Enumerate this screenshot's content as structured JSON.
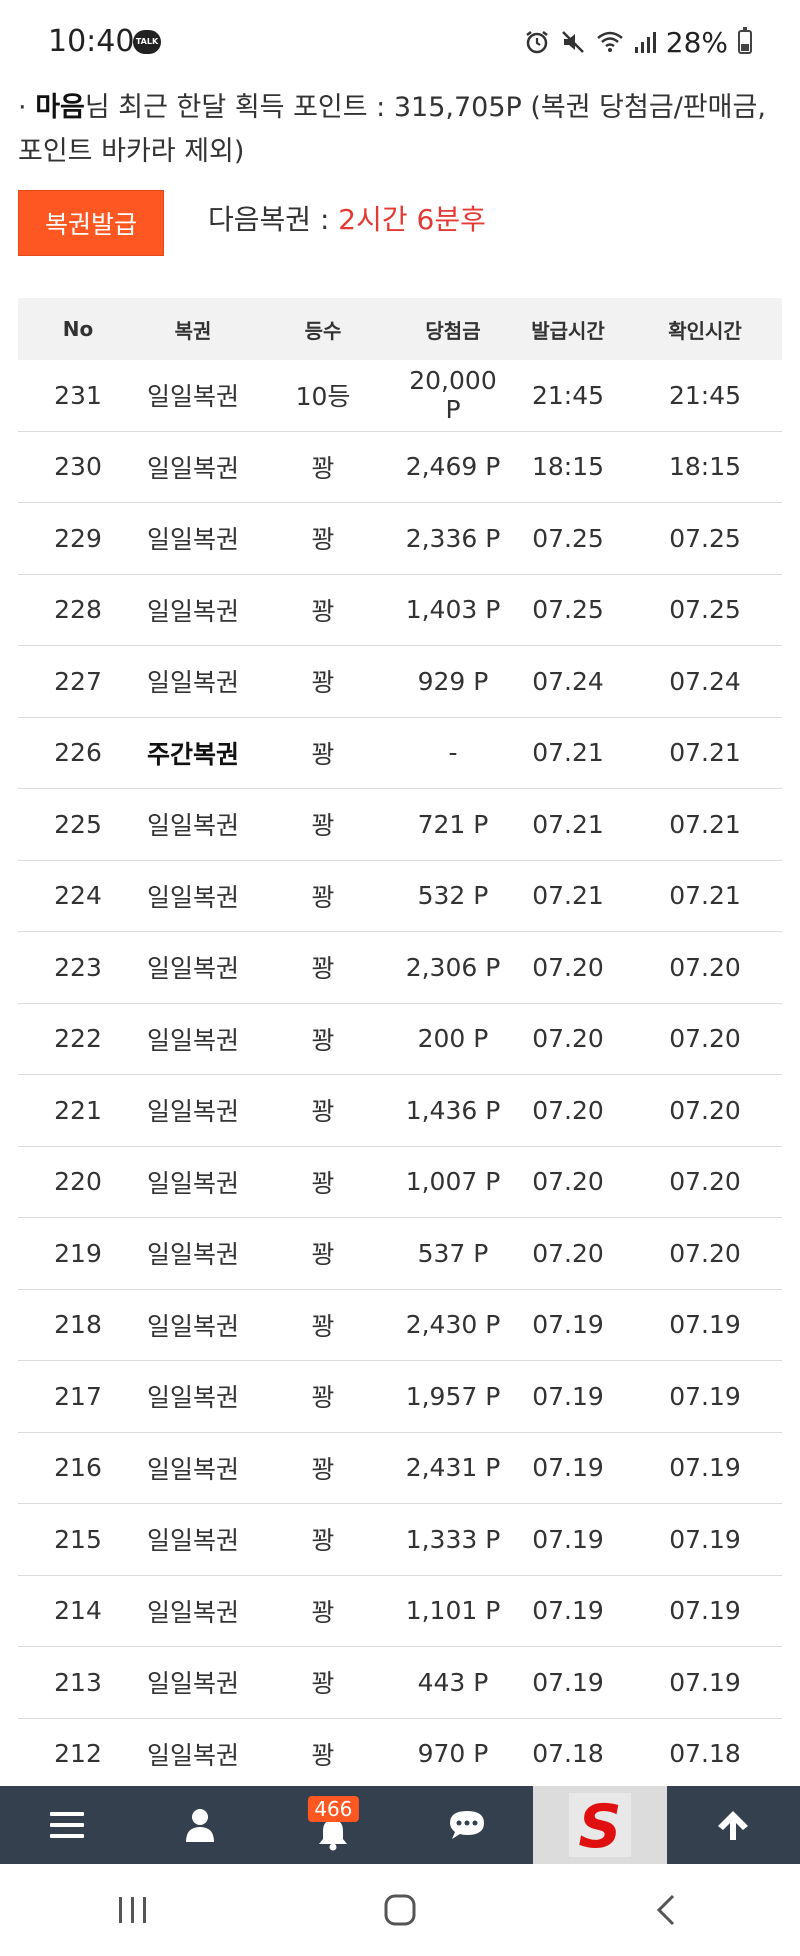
{
  "status_bar": {
    "time": "10:40",
    "talk_badge": "TALK",
    "battery": "28%",
    "icons": [
      "alarm-icon",
      "mute-icon",
      "wifi-icon",
      "signal-icon",
      "battery-icon"
    ]
  },
  "info": {
    "bullet": "·",
    "user": "마음",
    "text": "님 최근 한달 획득 포인트 : 315,705P (복권 당첨금/판매금, 포인트 바카라 제외)"
  },
  "issue_button": "복권발급",
  "next_lottery": {
    "label": "다음복권 : ",
    "time": "2시간 6분후"
  },
  "table": {
    "headers": {
      "no": "No",
      "type": "복권",
      "grade": "등수",
      "prize": "당첨금",
      "issued": "발급시간",
      "checked": "확인시간"
    },
    "rows": [
      {
        "no": "231",
        "type": "일일복권",
        "grade": "10등",
        "prize": "20,000 P",
        "issued": "21:45",
        "checked": "21:45"
      },
      {
        "no": "230",
        "type": "일일복권",
        "grade": "꽝",
        "prize": "2,469 P",
        "issued": "18:15",
        "checked": "18:15"
      },
      {
        "no": "229",
        "type": "일일복권",
        "grade": "꽝",
        "prize": "2,336 P",
        "issued": "07.25",
        "checked": "07.25"
      },
      {
        "no": "228",
        "type": "일일복권",
        "grade": "꽝",
        "prize": "1,403 P",
        "issued": "07.25",
        "checked": "07.25"
      },
      {
        "no": "227",
        "type": "일일복권",
        "grade": "꽝",
        "prize": "929 P",
        "issued": "07.24",
        "checked": "07.24"
      },
      {
        "no": "226",
        "type": "주간복권",
        "grade": "꽝",
        "prize": "-",
        "issued": "07.21",
        "checked": "07.21"
      },
      {
        "no": "225",
        "type": "일일복권",
        "grade": "꽝",
        "prize": "721 P",
        "issued": "07.21",
        "checked": "07.21"
      },
      {
        "no": "224",
        "type": "일일복권",
        "grade": "꽝",
        "prize": "532 P",
        "issued": "07.21",
        "checked": "07.21"
      },
      {
        "no": "223",
        "type": "일일복권",
        "grade": "꽝",
        "prize": "2,306 P",
        "issued": "07.20",
        "checked": "07.20"
      },
      {
        "no": "222",
        "type": "일일복권",
        "grade": "꽝",
        "prize": "200 P",
        "issued": "07.20",
        "checked": "07.20"
      },
      {
        "no": "221",
        "type": "일일복권",
        "grade": "꽝",
        "prize": "1,436 P",
        "issued": "07.20",
        "checked": "07.20"
      },
      {
        "no": "220",
        "type": "일일복권",
        "grade": "꽝",
        "prize": "1,007 P",
        "issued": "07.20",
        "checked": "07.20"
      },
      {
        "no": "219",
        "type": "일일복권",
        "grade": "꽝",
        "prize": "537 P",
        "issued": "07.20",
        "checked": "07.20"
      },
      {
        "no": "218",
        "type": "일일복권",
        "grade": "꽝",
        "prize": "2,430 P",
        "issued": "07.19",
        "checked": "07.19"
      },
      {
        "no": "217",
        "type": "일일복권",
        "grade": "꽝",
        "prize": "1,957 P",
        "issued": "07.19",
        "checked": "07.19"
      },
      {
        "no": "216",
        "type": "일일복권",
        "grade": "꽝",
        "prize": "2,431 P",
        "issued": "07.19",
        "checked": "07.19"
      },
      {
        "no": "215",
        "type": "일일복권",
        "grade": "꽝",
        "prize": "1,333 P",
        "issued": "07.19",
        "checked": "07.19"
      },
      {
        "no": "214",
        "type": "일일복권",
        "grade": "꽝",
        "prize": "1,101 P",
        "issued": "07.19",
        "checked": "07.19"
      },
      {
        "no": "213",
        "type": "일일복권",
        "grade": "꽝",
        "prize": "443 P",
        "issued": "07.19",
        "checked": "07.19"
      },
      {
        "no": "212",
        "type": "일일복권",
        "grade": "꽝",
        "prize": "970 P",
        "issued": "07.18",
        "checked": "07.18"
      }
    ]
  },
  "bottom_nav": {
    "items": [
      "menu-icon",
      "user-icon",
      "bell-icon",
      "chat-icon",
      "site-logo",
      "arrow-up-icon"
    ],
    "notification_count": "466",
    "logo_letter": "S"
  },
  "system_nav": [
    "recent-apps-icon",
    "home-icon",
    "back-icon"
  ],
  "colors": {
    "accent": "#ff5722",
    "highlight_red": "#e53935",
    "nav_bg": "#34404d"
  }
}
